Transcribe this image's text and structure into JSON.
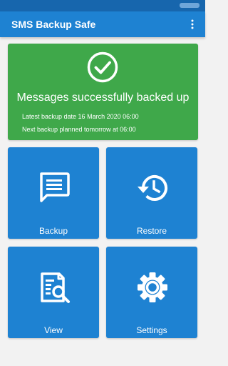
{
  "app": {
    "title": "SMS Backup Safe"
  },
  "toolbar": {
    "overflow_icon": "more-vert-icon"
  },
  "status": {
    "icon": "check-circle-icon",
    "title": "Messages successfully backed up",
    "latest_backup": "Latest backup date 16 March 2020 06:00",
    "next_backup": "Next backup planned tomorrow at 06:00",
    "color": "#3fa84a"
  },
  "tiles": [
    {
      "label": "Backup",
      "icon": "message-icon"
    },
    {
      "label": "Restore",
      "icon": "history-icon"
    },
    {
      "label": "View",
      "icon": "find-in-page-icon"
    },
    {
      "label": "Settings",
      "icon": "gear-icon"
    }
  ],
  "colors": {
    "primary": "#1e82d2",
    "primary_dark": "#1766ad",
    "background": "#f2f2f2"
  }
}
